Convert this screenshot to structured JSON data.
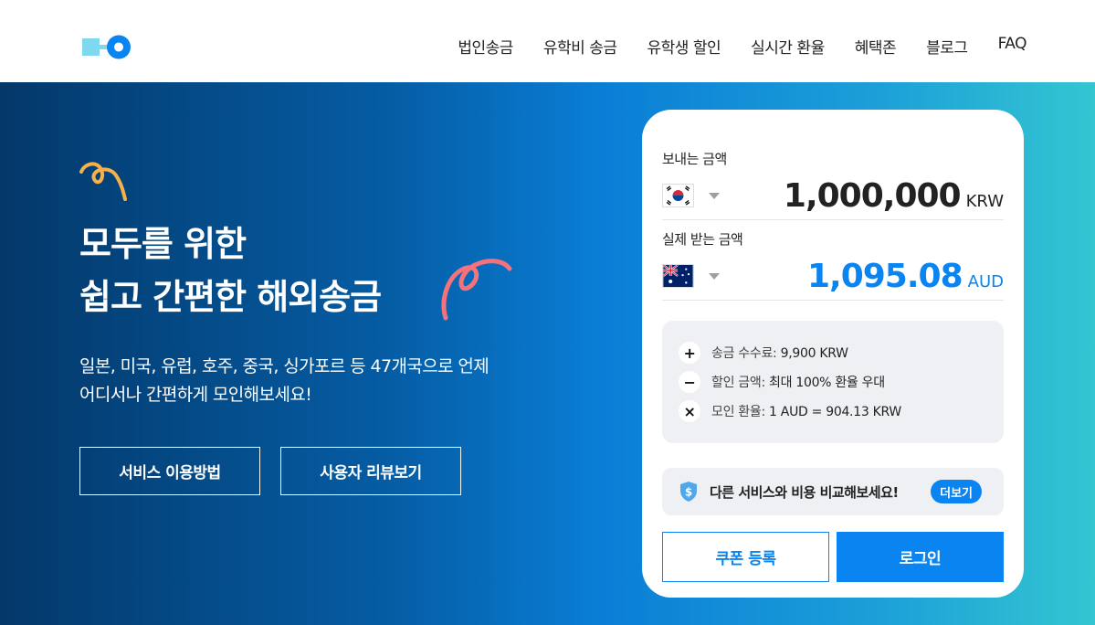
{
  "header": {
    "nav": [
      "법인송금",
      "유학비 송금",
      "유학생 할인",
      "실시간 환율",
      "혜택존",
      "블로그",
      "FAQ"
    ]
  },
  "hero": {
    "headline_line1": "모두를 위한",
    "headline_line2": "쉽고 간편한 해외송금",
    "sub_line1": "일본, 미국, 유럽, 호주, 중국, 싱가포르 등 47개국으로 언제",
    "sub_line2": "어디서나 간편하게 모인해보세요!",
    "btn_howto": "서비스 이용방법",
    "btn_review": "사용자 리뷰보기"
  },
  "calculator": {
    "send_label": "보내는 금액",
    "send_amount": "1,000,000",
    "send_currency": "KRW",
    "receive_label": "실제 받는 금액",
    "receive_amount": "1,095.08",
    "receive_currency": "AUD",
    "fee_label": "송금 수수료:",
    "fee_value": "9,900 KRW",
    "discount_label": "할인 금액:",
    "discount_value": "최대 100% 환율 우대",
    "rate_label": "모인 환율:",
    "rate_value": "1 AUD = 904.13 KRW",
    "compare_text": "다른 서비스와 비용 비교해보세요!",
    "more_label": "더보기",
    "coupon_label": "쿠폰 등록",
    "login_label": "로그인"
  },
  "colors": {
    "accent": "#0a84f0",
    "hero_start": "#04386a",
    "hero_end": "#33c6d1",
    "squiggle_yellow": "#f7b14a",
    "squiggle_pink": "#f6727a"
  }
}
